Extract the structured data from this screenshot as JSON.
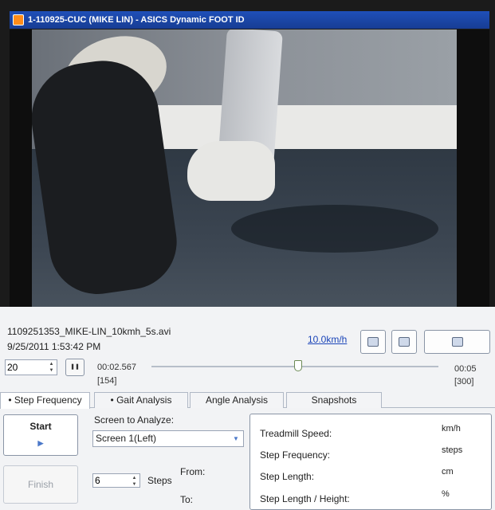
{
  "window": {
    "title": "1-110925-CUC (MIKE LIN) - ASICS Dynamic FOOT ID"
  },
  "file": {
    "name": "1109251353_MIKE-LIN_10kmh_5s.avi",
    "date": "9/25/2011 1:53:42 PM",
    "speed": "10.0km/h"
  },
  "playback": {
    "frame_value": "20",
    "current_time": "00:02.567",
    "current_frame": "[154]",
    "end_time": "00:05",
    "end_frame": "[300]",
    "position_fraction": 0.51
  },
  "tabs": [
    {
      "label": "Step Frequency",
      "active": true
    },
    {
      "label": "Gait Analysis",
      "active": false
    },
    {
      "label": "Angle Analysis",
      "active": false
    },
    {
      "label": "Snapshots",
      "active": false
    }
  ],
  "controls": {
    "start_label": "Start",
    "finish_label": "Finish",
    "screen_label": "Screen to Analyze:",
    "screen_value": "Screen 1(Left)",
    "steps_value": "6",
    "steps_label": "Steps",
    "from_label": "From:",
    "to_label": "To:"
  },
  "results": [
    {
      "label": "Treadmill Speed:",
      "unit": "km/h"
    },
    {
      "label": "Step Frequency:",
      "unit": "steps"
    },
    {
      "label": "Step Length:",
      "unit": "cm"
    },
    {
      "label": "Step Length / Height:",
      "unit": "%"
    }
  ]
}
